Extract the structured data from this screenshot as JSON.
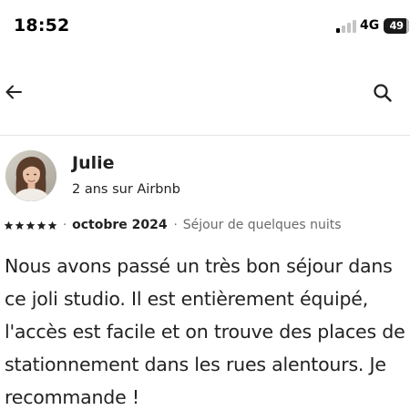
{
  "status_bar": {
    "time": "18:52",
    "network": "4G",
    "battery_level": "49",
    "signal_bars_active": 1,
    "signal_bars_total": 4
  },
  "header": {
    "back_icon": "arrow-left-icon",
    "search_icon": "search-icon"
  },
  "review": {
    "reviewer_name": "Julie",
    "member_since": "2 ans sur Airbnb",
    "rating": 5,
    "rating_max": 5,
    "separator": "·",
    "date": "octobre 2024",
    "stay_type": "Séjour de quelques nuits",
    "text": "Nous avons passé un très bon séjour dans ce joli studio. Il est entièrement équipé, l'accès est facile et on trouve des places de stationnement dans les rues alentours. Je recommande !"
  },
  "colors": {
    "text_primary": "#222222",
    "text_secondary": "#6a6a6a",
    "divider": "#e4e4e4",
    "background": "#ffffff"
  }
}
